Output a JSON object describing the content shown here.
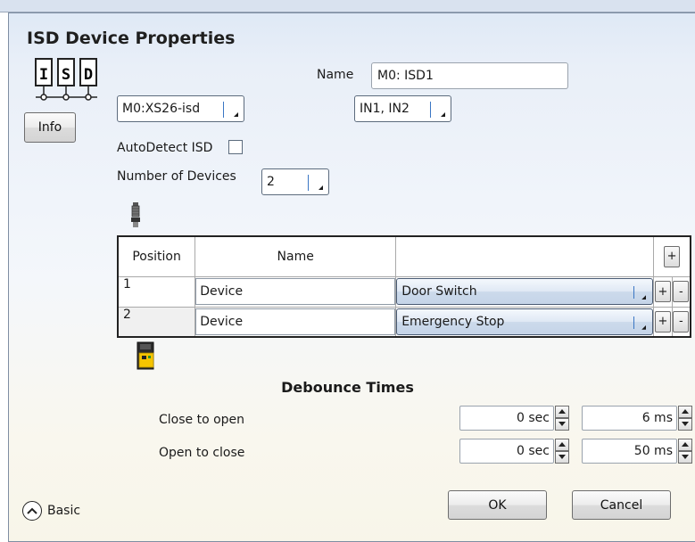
{
  "dialog": {
    "title": "ISD Device Properties",
    "info_label": "Info",
    "name_label": "Name",
    "name_value": "M0: ISD1",
    "module_select": "M0:XS26-isd",
    "inputs_select": "IN1, IN2",
    "autodetect_label": "AutoDetect ISD",
    "autodetect_checked": false,
    "num_devices_label": "Number of Devices",
    "num_devices_value": "2"
  },
  "table": {
    "headers": [
      "Position",
      "Name",
      "",
      "+"
    ],
    "rows": [
      {
        "position": "1",
        "name": "Device",
        "type": "Door Switch"
      },
      {
        "position": "2",
        "name": "Device",
        "type": "Emergency Stop"
      }
    ],
    "add_label": "+",
    "remove_label": "-"
  },
  "debounce": {
    "title": "Debounce Times",
    "close_to_open_label": "Close to open",
    "open_to_close_label": "Open to close",
    "close_to_open_sec": "0 sec",
    "close_to_open_ms": "6 ms",
    "open_to_close_sec": "0 sec",
    "open_to_close_ms": "50 ms"
  },
  "footer": {
    "basic_label": "Basic",
    "ok_label": "OK",
    "cancel_label": "Cancel"
  },
  "icons": {
    "isd": "isd-chain-icon",
    "sensor": "sensor-plug-icon",
    "device": "safety-device-icon",
    "basic": "chevron-up-icon"
  }
}
